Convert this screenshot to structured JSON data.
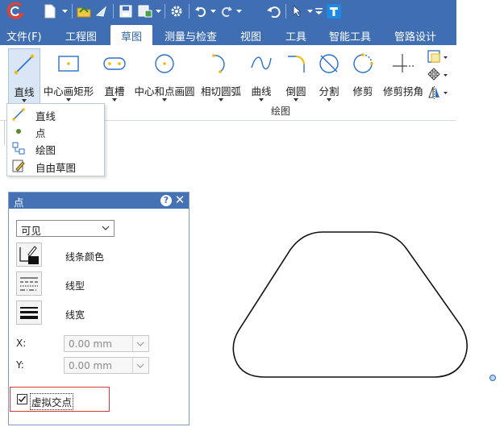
{
  "menu": {
    "items": [
      {
        "label": "文件(F)"
      },
      {
        "label": "工程图"
      },
      {
        "label": "草图",
        "active": true
      },
      {
        "label": "测量与检查"
      },
      {
        "label": "视图"
      },
      {
        "label": "工具"
      },
      {
        "label": "智能工具"
      },
      {
        "label": "管路设计"
      }
    ]
  },
  "ribbon": {
    "tools": [
      {
        "label": "直线"
      },
      {
        "label": "中心画矩形"
      },
      {
        "label": "直槽"
      },
      {
        "label": "中心和点画圆"
      },
      {
        "label": "相切圆弧"
      },
      {
        "label": "曲线"
      },
      {
        "label": "倒圆"
      },
      {
        "label": "分割"
      },
      {
        "label": "修剪"
      },
      {
        "label": "修剪拐角"
      }
    ],
    "group_label": "绘图"
  },
  "dropdown": {
    "items": [
      {
        "label": "直线",
        "icon": "line-icon"
      },
      {
        "label": "点",
        "icon": "point-icon"
      },
      {
        "label": "绘图",
        "icon": "sketch-icon"
      },
      {
        "label": "自由草图",
        "icon": "freehand-icon"
      }
    ]
  },
  "panel": {
    "title": "点",
    "help": "?",
    "close": "✕",
    "visibility": "可见",
    "line_color_label": "线条颜色",
    "line_type_label": "线型",
    "line_width_label": "线宽",
    "x_label": "X:",
    "x_value": "0.00 mm",
    "y_label": "Y:",
    "y_value": "0.00 mm",
    "virtual_label": "虚拟交点",
    "virtual_checked": true
  },
  "colors": {
    "title_bar": "#3f6fb2",
    "panel_header": "#4472b4",
    "highlight_box": "#d9363e",
    "accent_yellow": "#f2b800"
  }
}
